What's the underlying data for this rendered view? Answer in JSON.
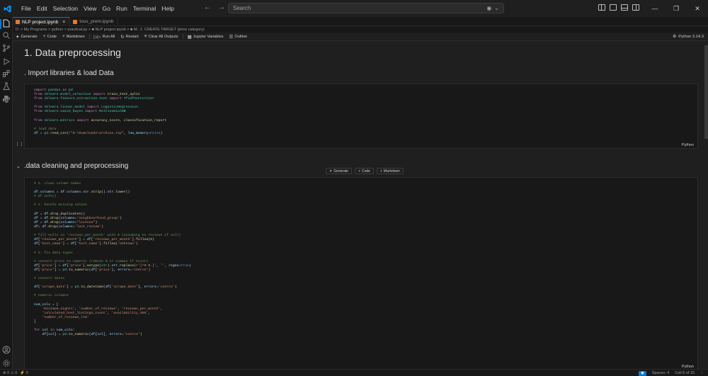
{
  "titlebar": {
    "menu": [
      "File",
      "Edit",
      "Selection",
      "View",
      "Go",
      "Run",
      "Terminal",
      "Help"
    ],
    "search_placeholder": "Search"
  },
  "tabs": [
    {
      "label": "NLP project.ipynb",
      "active": true
    },
    {
      "label": "tous_prem.ipynb",
      "active": false
    }
  ],
  "breadcrumb": "D: > My Programs > python > practical.py > ■ NLP project.ipynb > ■ M↓ 2. CREATE TARGET (price category)",
  "toolbar": {
    "generate": "Generate",
    "code": "Code",
    "markdown": "Markdown",
    "run_all": "Run All",
    "restart": "Restart",
    "clear_outputs": "Clear All Outputs",
    "jupyter_vars": "Jupyter Variables",
    "outline": "Outline",
    "kernel": "Python 3.14.3"
  },
  "notebook": {
    "heading1": "1. Data preprocessing",
    "heading2a": ". Import libraries & load Data",
    "heading2b": ".data cleaning and preprocessing",
    "cell1_exec": "[ ]",
    "cell1_lang": "Python",
    "cell2_lang": "Python",
    "insert": {
      "generate": "Generate",
      "code": "Code",
      "markdown": "Markdown"
    }
  },
  "status": {
    "errors": "0",
    "warnings": "0",
    "ports": "0",
    "spaces": "Spaces: 4",
    "cell": "Cell 6 of 15"
  }
}
